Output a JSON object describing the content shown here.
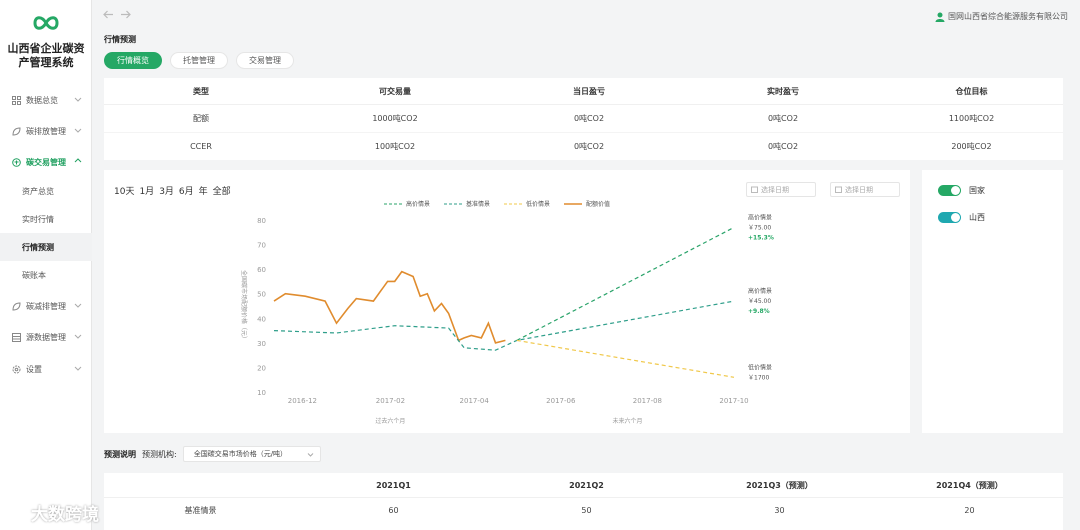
{
  "app": {
    "title": "山西省企业碳资产管理系统",
    "title_line1": "山西省企业碳资",
    "title_line2": "产管理系统",
    "user": "国网山西省综合能源服务有限公司"
  },
  "sidebar": {
    "items": [
      {
        "label": "数据总览",
        "icon": "grid-icon"
      },
      {
        "label": "碳排放管理",
        "icon": "leaf-icon"
      },
      {
        "label": "碳交易管理",
        "icon": "exchange-icon",
        "active": true
      },
      {
        "label": "碳减排管理",
        "icon": "leaf-icon"
      },
      {
        "label": "源数据管理",
        "icon": "database-icon"
      },
      {
        "label": "设置",
        "icon": "gear-icon"
      }
    ],
    "sub_items": [
      {
        "label": "资产总览"
      },
      {
        "label": "实时行情"
      },
      {
        "label": "行情预测",
        "active": true
      },
      {
        "label": "碳账本"
      }
    ]
  },
  "page": {
    "title": "行情预测",
    "tabs": [
      {
        "label": "行情概览",
        "active": true
      },
      {
        "label": "托管管理"
      },
      {
        "label": "交易管理"
      }
    ]
  },
  "summary_table": {
    "headers": [
      "类型",
      "可交易量",
      "当日盈亏",
      "实时盈亏",
      "仓位目标"
    ],
    "rows": [
      [
        "配额",
        "1000吨CO2",
        "0吨CO2",
        "0吨CO2",
        "1100吨CO2"
      ],
      [
        "CCER",
        "100吨CO2",
        "0吨CO2",
        "0吨CO2",
        "200吨CO2"
      ]
    ]
  },
  "chart_panel": {
    "ranges": [
      "10天",
      "1月",
      "3月",
      "6月",
      "年",
      "全部"
    ],
    "start_date_placeholder": "选择日期",
    "end_date_placeholder": "选择日期"
  },
  "toggles": [
    {
      "label": "国家",
      "on": true,
      "color": "#25a865"
    },
    {
      "label": "山西",
      "on": true,
      "color": "#1fa8b0"
    }
  ],
  "forecast": {
    "title": "预测说明",
    "org_label": "预测机构:",
    "org_value": "全国碳交易市场价格（元/吨）",
    "headers": [
      "",
      "2021Q1",
      "2021Q2",
      "2021Q3（预测）",
      "2021Q4（预测）"
    ],
    "rows": [
      [
        "基准情景",
        "60",
        "50",
        "30",
        "20"
      ]
    ]
  },
  "colors": {
    "accent": "#25a865",
    "history": "#e08c2e",
    "high": "#2aa36a",
    "base": "#2e9e8a",
    "low": "#f0c84a"
  },
  "watermark": "大数跨境",
  "chart_data": {
    "type": "line",
    "ylabel": "全国碳市场配额价格（元）",
    "ylim": [
      10,
      80
    ],
    "yticks": [
      10,
      20,
      30,
      40,
      50,
      60,
      70,
      80
    ],
    "x_ticks": [
      "2016-12",
      "2017-02",
      "2017-04",
      "2017-06",
      "2017-08",
      "2017-10"
    ],
    "x_sections": [
      "过去六个月",
      "未来六个月"
    ],
    "legend": [
      "高价情景",
      "基准情景",
      "低价情景",
      "配额价值"
    ],
    "series": [
      {
        "name": "配额价值",
        "style": "solid",
        "x": [
          "2016-11-25",
          "2016-12-03",
          "2016-12-17",
          "2016-12-31",
          "2017-01-08",
          "2017-01-16",
          "2017-01-22",
          "2017-02-03",
          "2017-02-13",
          "2017-02-18",
          "2017-02-23",
          "2017-03-03",
          "2017-03-08",
          "2017-03-13",
          "2017-03-18",
          "2017-03-23",
          "2017-03-28",
          "2017-04-04",
          "2017-04-08",
          "2017-04-13",
          "2017-04-20",
          "2017-04-25",
          "2017-04-30",
          "2017-05-07"
        ],
        "values": [
          47,
          50,
          49,
          47,
          38,
          44,
          48,
          47,
          55,
          55,
          59,
          57,
          49,
          50,
          43,
          46,
          42,
          31,
          32,
          33,
          32,
          38,
          30,
          31
        ]
      },
      {
        "name": "基准情景",
        "style": "dashed",
        "x": [
          "2016-11-25",
          "2017-01-08",
          "2017-02-18",
          "2017-03-28",
          "2017-04-08",
          "2017-04-30",
          "2017-05-15",
          "2017-10-15"
        ],
        "values": [
          35,
          34,
          37,
          36,
          28,
          27,
          31,
          47
        ]
      },
      {
        "name": "高价情景",
        "style": "dashed",
        "x": [
          "2017-05-15",
          "2017-10-15"
        ],
        "values": [
          31,
          77
        ]
      },
      {
        "name": "低价情景",
        "style": "dashed",
        "x": [
          "2017-05-15",
          "2017-10-15"
        ],
        "values": [
          31,
          16
        ]
      }
    ],
    "annotations": [
      {
        "title": "高价情景",
        "price": "￥75.00",
        "change": "+15.3%"
      },
      {
        "title": "高价情景",
        "price": "￥45.00",
        "change": "+9.8%"
      },
      {
        "title": "低价情景",
        "price": "￥1700",
        "change": ""
      }
    ]
  }
}
